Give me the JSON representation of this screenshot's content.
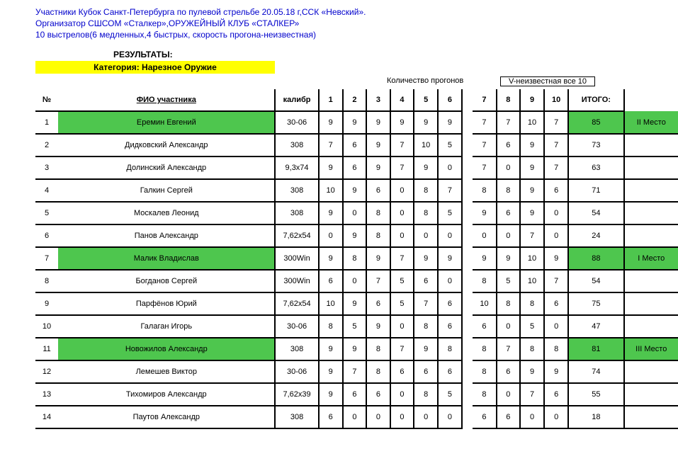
{
  "header": {
    "line1": "Участники Кубок Санкт-Петербурга по пулевой стрельбе  20.05.18 г,ССК «Невский».",
    "line2": "Организатор СШСОМ «Сталкер»,ОРУЖЕЙНЫЙ КЛУБ «СТАЛКЕР»",
    "line3": " 10 выстрелов(6 медленных,4 быстрых, скорость прогона-неизвестная)"
  },
  "labels": {
    "results": "РЕЗУЛЬТАТЫ:",
    "category": "Категория: Нарезное Оружие",
    "group1": "Количество прогонов",
    "group2": "V-неизвестная все 10"
  },
  "columns": {
    "num": "№",
    "name": "ФИО участника",
    "caliber": "калибр",
    "s1": "1",
    "s2": "2",
    "s3": "3",
    "s4": "4",
    "s5": "5",
    "s6": "6",
    "s7": "7",
    "s8": "8",
    "s9": "9",
    "s10": "10",
    "total": "ИТОГО:"
  },
  "rows": [
    {
      "n": "1",
      "name": "Еремин Евгений",
      "cal": "30-06",
      "s": [
        "9",
        "9",
        "9",
        "9",
        "9",
        "9",
        "7",
        "7",
        "10",
        "7"
      ],
      "total": "85",
      "place": "II Место",
      "hl": true
    },
    {
      "n": "2",
      "name": "Дидковский Александр",
      "cal": "308",
      "s": [
        "7",
        "6",
        "9",
        "7",
        "10",
        "5",
        "7",
        "6",
        "9",
        "7"
      ],
      "total": "73",
      "place": "",
      "hl": false
    },
    {
      "n": "3",
      "name": "Долинский Александр",
      "cal": "9,3х74",
      "s": [
        "9",
        "6",
        "9",
        "7",
        "9",
        "0",
        "7",
        "0",
        "9",
        "7"
      ],
      "total": "63",
      "place": "",
      "hl": false
    },
    {
      "n": "4",
      "name": "Галкин Сергей",
      "cal": "308",
      "s": [
        "10",
        "9",
        "6",
        "0",
        "8",
        "7",
        "8",
        "8",
        "9",
        "6"
      ],
      "total": "71",
      "place": "",
      "hl": false
    },
    {
      "n": "5",
      "name": "Москалев Леонид",
      "cal": "308",
      "s": [
        "9",
        "0",
        "8",
        "0",
        "8",
        "5",
        "9",
        "6",
        "9",
        "0"
      ],
      "total": "54",
      "place": "",
      "hl": false
    },
    {
      "n": "6",
      "name": "Панов Александр",
      "cal": "7,62х54",
      "s": [
        "0",
        "9",
        "8",
        "0",
        "0",
        "0",
        "0",
        "0",
        "7",
        "0"
      ],
      "total": "24",
      "place": "",
      "hl": false
    },
    {
      "n": "7",
      "name": "Малик Владислав",
      "cal": "300Win",
      "s": [
        "9",
        "8",
        "9",
        "7",
        "9",
        "9",
        "9",
        "9",
        "10",
        "9"
      ],
      "total": "88",
      "place": "I Место",
      "hl": true
    },
    {
      "n": "8",
      "name": "Богданов Сергей",
      "cal": "300Win",
      "s": [
        "6",
        "0",
        "7",
        "5",
        "6",
        "0",
        "8",
        "5",
        "10",
        "7"
      ],
      "total": "54",
      "place": "",
      "hl": false
    },
    {
      "n": "9",
      "name": "Парфёнов Юрий",
      "cal": "7,62х54",
      "s": [
        "10",
        "9",
        "6",
        "5",
        "7",
        "6",
        "10",
        "8",
        "8",
        "6"
      ],
      "total": "75",
      "place": "",
      "hl": false
    },
    {
      "n": "10",
      "name": "Галаган Игорь",
      "cal": "30-06",
      "s": [
        "8",
        "5",
        "9",
        "0",
        "8",
        "6",
        "6",
        "0",
        "5",
        "0"
      ],
      "total": "47",
      "place": "",
      "hl": false
    },
    {
      "n": "11",
      "name": "Новожилов Александр",
      "cal": "308",
      "s": [
        "9",
        "9",
        "8",
        "7",
        "9",
        "8",
        "8",
        "7",
        "8",
        "8"
      ],
      "total": "81",
      "place": "III Место",
      "hl": true
    },
    {
      "n": "12",
      "name": "Лемешев Виктор",
      "cal": "30-06",
      "s": [
        "9",
        "7",
        "8",
        "6",
        "6",
        "6",
        "8",
        "6",
        "9",
        "9"
      ],
      "total": "74",
      "place": "",
      "hl": false
    },
    {
      "n": "13",
      "name": "Тихомиров Александр",
      "cal": "7,62х39",
      "s": [
        "9",
        "6",
        "6",
        "0",
        "8",
        "5",
        "8",
        "0",
        "7",
        "6"
      ],
      "total": "55",
      "place": "",
      "hl": false
    },
    {
      "n": "14",
      "name": "Паутов Александр",
      "cal": "308",
      "s": [
        "6",
        "0",
        "0",
        "0",
        "0",
        "0",
        "6",
        "6",
        "0",
        "0"
      ],
      "total": "18",
      "place": "",
      "hl": false
    }
  ]
}
